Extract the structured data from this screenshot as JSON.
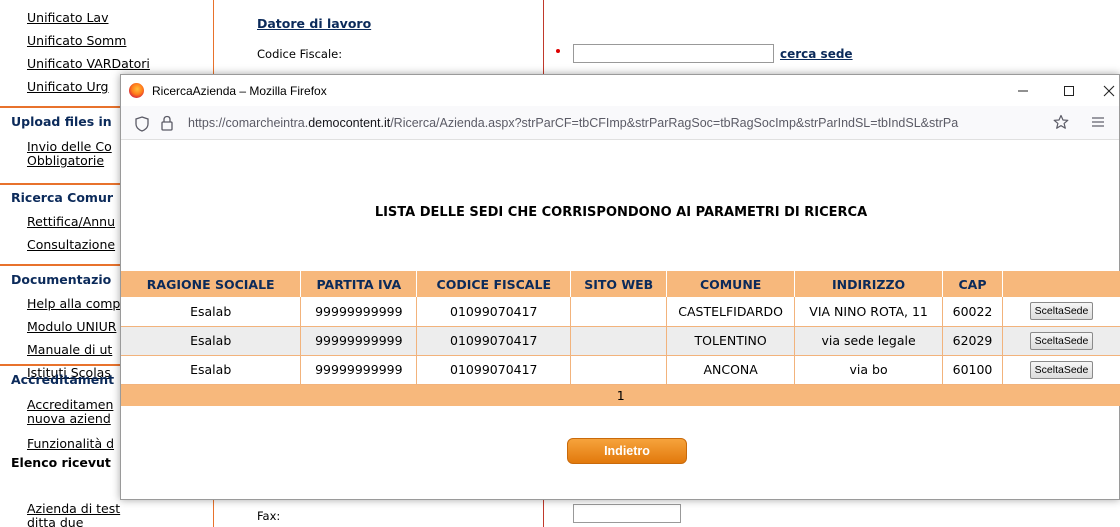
{
  "background": {
    "sidebar": {
      "group1": [
        "Unificato Lav",
        "Unificato Somm",
        "Unificato VARDatori",
        "Unificato Urg"
      ],
      "upload_head": "Upload files in",
      "upload_items": [
        "Invio delle Co",
        "Obbligatorie"
      ],
      "ricerca_head": "Ricerca Comur",
      "ricerca_items": [
        "Rettifica/Annu",
        "Consultazione"
      ],
      "doc_head": "Documentazio",
      "doc_items": [
        "Help alla comp",
        "Modulo UNIUR",
        "Manuale di ut",
        "Istituti Scolas"
      ],
      "accred_head": "Accreditament",
      "accred_items": [
        "Accreditamen",
        "nuova aziend",
        "Funzionalità d"
      ],
      "elenco_head": "Elenco ricevut",
      "elenco_items": [
        "Azienda di test",
        "ditta due"
      ]
    },
    "form": {
      "section_title": "Datore di lavoro",
      "cf_label": "Codice Fiscale:",
      "cerca_sede": "cerca sede",
      "fax_label": "Fax:"
    }
  },
  "popup": {
    "title": "RicercaAzienda – Mozilla Firefox",
    "url_prefix": "https://comarcheintra.",
    "url_domain": "democontent.it",
    "url_rest": "/Ricerca/Azienda.aspx?strParCF=tbCFImp&strParRagSoc=tbRagSocImp&strParIndSL=tbIndSL&strPa",
    "heading": "LISTA DELLE SEDI CHE CORRISPONDONO AI PARAMETRI DI RICERCA",
    "table": {
      "headers": [
        "RAGIONE SOCIALE",
        "PARTITA IVA",
        "CODICE FISCALE",
        "SITO WEB",
        "COMUNE",
        "INDIRIZZO",
        "CAP",
        ""
      ],
      "rows": [
        {
          "ragione": "Esalab",
          "piva": "99999999999",
          "cf": "01099070417",
          "sito": "",
          "comune": "CASTELFIDARDO",
          "indirizzo": "VIA NINO ROTA, 11",
          "cap": "60022",
          "action": "SceltaSede"
        },
        {
          "ragione": "Esalab",
          "piva": "99999999999",
          "cf": "01099070417",
          "sito": "",
          "comune": "TOLENTINO",
          "indirizzo": "via sede legale",
          "cap": "62029",
          "action": "SceltaSede"
        },
        {
          "ragione": "Esalab",
          "piva": "99999999999",
          "cf": "01099070417",
          "sito": "",
          "comune": "ANCONA",
          "indirizzo": "via bo",
          "cap": "60100",
          "action": "SceltaSede"
        }
      ],
      "page": "1"
    },
    "back_label": "Indietro"
  },
  "colors": {
    "accent_orange": "#f7b87c",
    "button_orange": "#e2790c",
    "nav_blue": "#0b2a5a",
    "separator": "#e8722c"
  }
}
